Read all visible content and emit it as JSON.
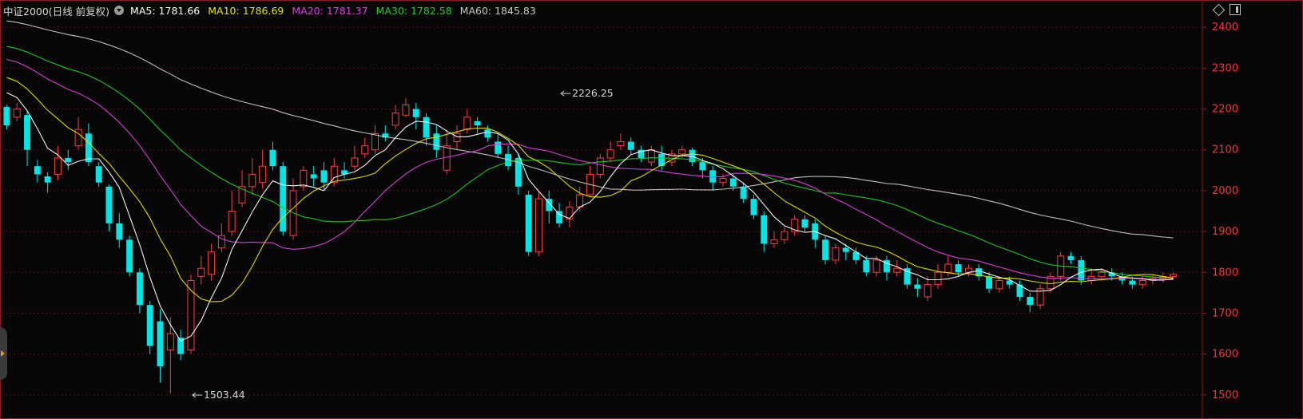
{
  "header": {
    "title": "中证2000(日线 前复权)",
    "ma": [
      {
        "key": "MA5:",
        "value": "1781.66",
        "color": "#ffffff"
      },
      {
        "key": "MA10:",
        "value": "1786.69",
        "color": "#e6e600"
      },
      {
        "key": "MA20:",
        "value": "1781.37",
        "color": "#e040e0"
      },
      {
        "key": "MA30:",
        "value": "1782.58",
        "color": "#20d020"
      },
      {
        "key": "MA60:",
        "value": "1845.83",
        "color": "#c8c8c8"
      }
    ]
  },
  "colors": {
    "up": "#ff3c3c",
    "down": "#00e5e5",
    "grid": "#5a1010",
    "axis_text": "#ff3030",
    "axis_line": "#8b1a1a"
  },
  "chart_data": {
    "type": "candlestick",
    "ylim": [
      1480,
      2420
    ],
    "yticks": [
      1500,
      1600,
      1700,
      1800,
      1900,
      2000,
      2100,
      2200,
      2300,
      2400
    ],
    "annotations": [
      {
        "label": "2226.25",
        "value": 2226.25,
        "index": 54
      },
      {
        "label": "1503.44",
        "value": 1503.44,
        "index": 18
      }
    ],
    "candles": [
      [
        2205,
        2160,
        2210,
        2150
      ],
      [
        2180,
        2200,
        2215,
        2170
      ],
      [
        2185,
        2100,
        2195,
        2060
      ],
      [
        2060,
        2040,
        2075,
        2020
      ],
      [
        2035,
        2020,
        2045,
        1995
      ],
      [
        2040,
        2080,
        2110,
        2025
      ],
      [
        2080,
        2070,
        2100,
        2050
      ],
      [
        2110,
        2150,
        2180,
        2100
      ],
      [
        2140,
        2070,
        2165,
        2060
      ],
      [
        2060,
        2020,
        2070,
        2010
      ],
      [
        2010,
        1920,
        2015,
        1900
      ],
      [
        1920,
        1880,
        1945,
        1860
      ],
      [
        1880,
        1800,
        1890,
        1790
      ],
      [
        1800,
        1720,
        1810,
        1700
      ],
      [
        1720,
        1620,
        1730,
        1600
      ],
      [
        1680,
        1570,
        1710,
        1530
      ],
      [
        1610,
        1650,
        1690,
        1503.44
      ],
      [
        1640,
        1600,
        1660,
        1585
      ],
      [
        1610,
        1780,
        1795,
        1600
      ],
      [
        1790,
        1810,
        1840,
        1770
      ],
      [
        1795,
        1850,
        1870,
        1780
      ],
      [
        1860,
        1890,
        1920,
        1850
      ],
      [
        1900,
        1950,
        2000,
        1890
      ],
      [
        1970,
        2010,
        2050,
        1960
      ],
      [
        2010,
        2040,
        2080,
        1990
      ],
      [
        2020,
        2060,
        2100,
        2005
      ],
      [
        2100,
        2060,
        2120,
        2050
      ],
      [
        2060,
        1900,
        2070,
        1890
      ],
      [
        1890,
        2000,
        2030,
        1880
      ],
      [
        2010,
        2050,
        2060,
        2000
      ],
      [
        2040,
        2030,
        2060,
        2010
      ],
      [
        2050,
        2020,
        2070,
        2000
      ],
      [
        2020,
        2060,
        2080,
        2010
      ],
      [
        2050,
        2040,
        2070,
        2030
      ],
      [
        2060,
        2080,
        2110,
        2050
      ],
      [
        2090,
        2110,
        2130,
        2080
      ],
      [
        2100,
        2140,
        2160,
        2090
      ],
      [
        2140,
        2130,
        2160,
        2120
      ],
      [
        2160,
        2190,
        2210,
        2150
      ],
      [
        2185,
        2210,
        2226.25,
        2180
      ],
      [
        2200,
        2180,
        2215,
        2150
      ],
      [
        2180,
        2130,
        2190,
        2110
      ],
      [
        2140,
        2100,
        2160,
        2080
      ],
      [
        2050,
        2110,
        2150,
        2040
      ],
      [
        2120,
        2140,
        2160,
        2100
      ],
      [
        2150,
        2180,
        2200,
        2140
      ],
      [
        2170,
        2160,
        2180,
        2140
      ],
      [
        2150,
        2130,
        2160,
        2120
      ],
      [
        2120,
        2090,
        2140,
        2080
      ],
      [
        2090,
        2060,
        2110,
        2050
      ],
      [
        2080,
        2010,
        2090,
        1990
      ],
      [
        1990,
        1850,
        2000,
        1840
      ],
      [
        1850,
        1980,
        2000,
        1840
      ],
      [
        1980,
        1950,
        2000,
        1920
      ],
      [
        1950,
        1920,
        1970,
        1910
      ],
      [
        1930,
        1960,
        1975,
        1910
      ],
      [
        1960,
        1990,
        2010,
        1950
      ],
      [
        1990,
        2040,
        2060,
        1985
      ],
      [
        2040,
        2080,
        2090,
        2030
      ],
      [
        2080,
        2100,
        2120,
        2070
      ],
      [
        2110,
        2120,
        2140,
        2100
      ],
      [
        2120,
        2100,
        2130,
        2090
      ],
      [
        2100,
        2080,
        2110,
        2070
      ],
      [
        2070,
        2100,
        2110,
        2060
      ],
      [
        2090,
        2060,
        2110,
        2050
      ],
      [
        2070,
        2090,
        2100,
        2060
      ],
      [
        2090,
        2100,
        2110,
        2080
      ],
      [
        2100,
        2070,
        2105,
        2060
      ],
      [
        2070,
        2050,
        2080,
        2030
      ],
      [
        2050,
        2020,
        2060,
        2000
      ],
      [
        2020,
        2030,
        2040,
        2010
      ],
      [
        2030,
        2010,
        2040,
        2000
      ],
      [
        2010,
        1980,
        2020,
        1970
      ],
      [
        1980,
        1940,
        1990,
        1930
      ],
      [
        1940,
        1870,
        1950,
        1850
      ],
      [
        1870,
        1880,
        1900,
        1860
      ],
      [
        1880,
        1900,
        1910,
        1870
      ],
      [
        1900,
        1930,
        1940,
        1890
      ],
      [
        1930,
        1910,
        1940,
        1900
      ],
      [
        1920,
        1880,
        1930,
        1860
      ],
      [
        1880,
        1830,
        1890,
        1820
      ],
      [
        1830,
        1860,
        1870,
        1820
      ],
      [
        1860,
        1850,
        1870,
        1830
      ],
      [
        1850,
        1830,
        1860,
        1820
      ],
      [
        1830,
        1800,
        1840,
        1790
      ],
      [
        1800,
        1830,
        1840,
        1790
      ],
      [
        1830,
        1800,
        1840,
        1780
      ],
      [
        1800,
        1810,
        1830,
        1790
      ],
      [
        1810,
        1770,
        1820,
        1760
      ],
      [
        1770,
        1760,
        1785,
        1740
      ],
      [
        1740,
        1770,
        1790,
        1730
      ],
      [
        1770,
        1800,
        1820,
        1760
      ],
      [
        1800,
        1820,
        1840,
        1790
      ],
      [
        1820,
        1800,
        1830,
        1790
      ],
      [
        1800,
        1810,
        1820,
        1790
      ],
      [
        1810,
        1790,
        1820,
        1780
      ],
      [
        1790,
        1760,
        1800,
        1750
      ],
      [
        1760,
        1780,
        1790,
        1750
      ],
      [
        1780,
        1770,
        1790,
        1760
      ],
      [
        1770,
        1740,
        1780,
        1730
      ],
      [
        1740,
        1720,
        1750,
        1703
      ],
      [
        1720,
        1760,
        1770,
        1710
      ],
      [
        1760,
        1790,
        1800,
        1750
      ],
      [
        1790,
        1840,
        1850,
        1780
      ],
      [
        1840,
        1830,
        1850,
        1820
      ],
      [
        1830,
        1780,
        1840,
        1770
      ],
      [
        1780,
        1790,
        1810,
        1770
      ],
      [
        1790,
        1800,
        1810,
        1780
      ],
      [
        1800,
        1790,
        1810,
        1780
      ],
      [
        1790,
        1780,
        1800,
        1770
      ],
      [
        1780,
        1770,
        1790,
        1760
      ],
      [
        1770,
        1780,
        1790,
        1760
      ],
      [
        1780,
        1785,
        1795,
        1770
      ],
      [
        1785,
        1790,
        1800,
        1775
      ],
      [
        1790,
        1795,
        1800,
        1785
      ]
    ],
    "ma5_end": 1781.66,
    "ma10_end": 1786.69,
    "ma20_end": 1781.37,
    "ma30_end": 1782.58,
    "ma60_end": 1845.83
  }
}
